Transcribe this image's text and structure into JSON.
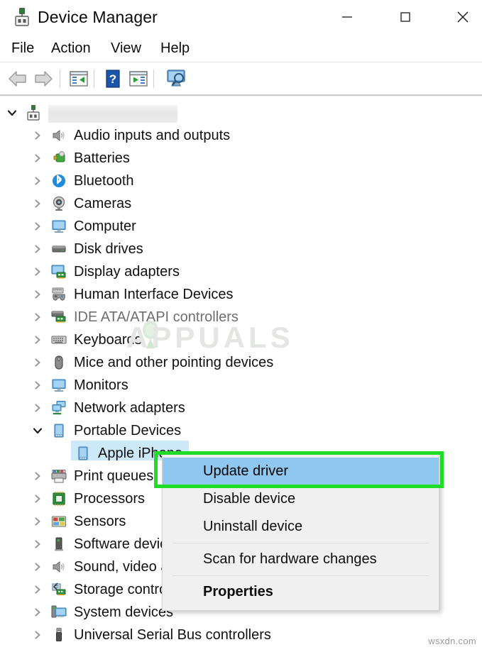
{
  "window": {
    "title": "Device Manager",
    "icon": "device-manager-icon",
    "controls": {
      "minimize": "—",
      "maximize": "□",
      "close": "✕"
    }
  },
  "menubar": {
    "items": [
      {
        "label": "File"
      },
      {
        "label": "Action"
      },
      {
        "label": "View"
      },
      {
        "label": "Help"
      }
    ]
  },
  "toolbar": {
    "buttons": [
      {
        "name": "back-button",
        "icon": "back-arrow-icon"
      },
      {
        "name": "forward-button",
        "icon": "forward-arrow-icon"
      },
      {
        "name": "properties-button",
        "icon": "properties-window-icon"
      },
      {
        "name": "help-button",
        "icon": "question-mark-icon"
      },
      {
        "name": "show-hidden-devices-button",
        "icon": "play-window-icon"
      },
      {
        "name": "scan-hardware-changes-button",
        "icon": "monitor-magnifier-icon"
      }
    ]
  },
  "tree": {
    "root": {
      "label": "",
      "redacted": true,
      "expanded": true,
      "icon": "computer-root-icon"
    },
    "items": [
      {
        "label": "Audio inputs and outputs",
        "icon": "speaker-icon",
        "expanded": false,
        "indent": 1
      },
      {
        "label": "Batteries",
        "icon": "battery-icon",
        "expanded": false,
        "indent": 1
      },
      {
        "label": "Bluetooth",
        "icon": "bluetooth-icon",
        "expanded": false,
        "indent": 1
      },
      {
        "label": "Cameras",
        "icon": "camera-icon",
        "expanded": false,
        "indent": 1
      },
      {
        "label": "Computer",
        "icon": "monitor-icon",
        "expanded": false,
        "indent": 1
      },
      {
        "label": "Disk drives",
        "icon": "disk-drive-icon",
        "expanded": false,
        "indent": 1
      },
      {
        "label": "Display adapters",
        "icon": "display-adapter-icon",
        "expanded": false,
        "indent": 1
      },
      {
        "label": "Human Interface Devices",
        "icon": "hid-gamepad-icon",
        "expanded": false,
        "indent": 1
      },
      {
        "label": "IDE ATA/ATAPI controllers",
        "icon": "ide-controller-icon",
        "expanded": false,
        "indent": 1
      },
      {
        "label": "Keyboards",
        "icon": "keyboard-icon",
        "expanded": false,
        "indent": 1
      },
      {
        "label": "Mice and other pointing devices",
        "icon": "mouse-icon",
        "expanded": false,
        "indent": 1
      },
      {
        "label": "Monitors",
        "icon": "monitor-icon",
        "expanded": false,
        "indent": 1
      },
      {
        "label": "Network adapters",
        "icon": "network-adapter-icon",
        "expanded": false,
        "indent": 1
      },
      {
        "label": "Portable Devices",
        "icon": "portable-device-icon",
        "expanded": true,
        "indent": 1
      },
      {
        "label": "Apple iPhone",
        "icon": "phone-icon",
        "expanded": null,
        "indent": 2,
        "selected": true
      },
      {
        "label": "Print queues",
        "icon": "printer-icon",
        "expanded": false,
        "indent": 1
      },
      {
        "label": "Processors",
        "icon": "processor-icon",
        "expanded": false,
        "indent": 1
      },
      {
        "label": "Sensors",
        "icon": "sensor-icon",
        "expanded": false,
        "indent": 1
      },
      {
        "label": "Software devices",
        "icon": "software-device-icon",
        "expanded": false,
        "indent": 1
      },
      {
        "label": "Sound, video and game controllers",
        "icon": "speaker-icon",
        "expanded": false,
        "indent": 1
      },
      {
        "label": "Storage controllers",
        "icon": "storage-controller-icon",
        "expanded": false,
        "indent": 1
      },
      {
        "label": "System devices",
        "icon": "system-device-icon",
        "expanded": false,
        "indent": 1
      },
      {
        "label": "Universal Serial Bus controllers",
        "icon": "usb-icon",
        "expanded": false,
        "indent": 1
      }
    ]
  },
  "context_menu": {
    "items": [
      {
        "label": "Update driver",
        "highlighted": true,
        "bold": false
      },
      {
        "label": "Disable device",
        "highlighted": false,
        "bold": false
      },
      {
        "label": "Uninstall device",
        "highlighted": false,
        "bold": false
      },
      {
        "separator": true
      },
      {
        "label": "Scan for hardware changes",
        "highlighted": false,
        "bold": false
      },
      {
        "separator": true
      },
      {
        "label": "Properties",
        "highlighted": false,
        "bold": true
      }
    ]
  },
  "annotation": {
    "highlight_color": "#1fdd26",
    "target": "Update driver"
  },
  "watermarks": {
    "center": "APPUALS",
    "bottom_right": "wsxdn.com"
  },
  "colors": {
    "selection": "#cde8f7",
    "menu_highlight": "#8ec7f0",
    "menu_background": "#f0f0f0",
    "accent_green": "#1fdd26"
  }
}
